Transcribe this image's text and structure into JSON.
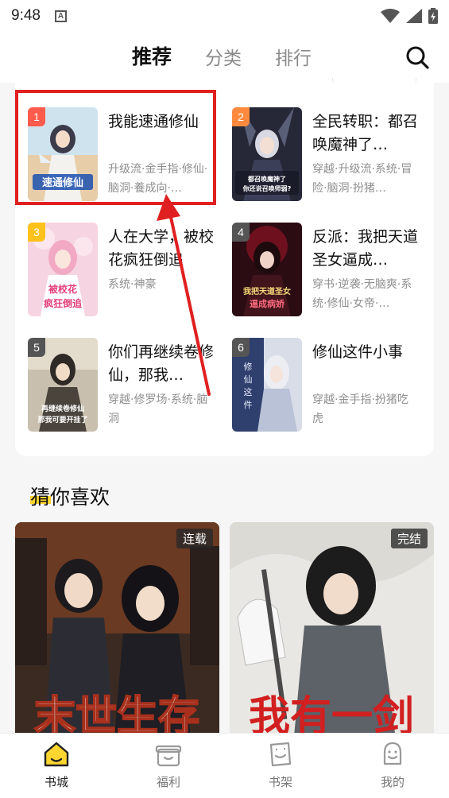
{
  "status_bar": {
    "time": "9:48",
    "notification_icon": "a-icon"
  },
  "top_nav": {
    "tabs": [
      {
        "label": "推荐",
        "active": true
      },
      {
        "label": "分类",
        "active": false
      },
      {
        "label": "排行",
        "active": false
      }
    ]
  },
  "ranking": {
    "books": [
      {
        "rank": "1",
        "title": "我能速通修仙",
        "tags": "升级流·金手指·修仙·脑洞·養成向·…",
        "rank_color": "#ff5b4d",
        "cover_text": "速通修仙"
      },
      {
        "rank": "2",
        "title": "全民转职：都召唤魔神了…",
        "tags": "穿越·升级流·系统·冒险·脑洞·扮猪…",
        "rank_color": "#ff8a3d",
        "cover_text": "都召唤魔神了 你还说召唤师弱?"
      },
      {
        "rank": "3",
        "title": "人在大学，被校花疯狂倒追",
        "tags": "系统·神豪",
        "rank_color": "#ffc21c",
        "cover_text": "被校花疯狂倒追"
      },
      {
        "rank": "4",
        "title": "反派：我把天道圣女逼成…",
        "tags": "穿书·逆袭·无脑爽·系统·修仙·女帝·…",
        "rank_color": "#555555",
        "cover_text": "我把天道圣女逼成病娇"
      },
      {
        "rank": "5",
        "title": "你们再继续卷修仙，那我…",
        "tags": "穿越·修罗场·系统·脑洞",
        "rank_color": "#555555",
        "cover_text": "你们再继续卷修仙 那我可要开挂了"
      },
      {
        "rank": "6",
        "title": "修仙这件小事",
        "tags": "穿越·金手指·扮猪吃虎",
        "rank_color": "#555555",
        "cover_text": "修仙这件小事"
      }
    ]
  },
  "guess_section": {
    "title": "猜你喜欢",
    "items": [
      {
        "badge": "连载",
        "cover_text": "末世生存"
      },
      {
        "badge": "完结",
        "cover_text": "我有一剑"
      }
    ]
  },
  "bottom_nav": {
    "items": [
      {
        "label": "书城",
        "icon": "home-icon",
        "active": true
      },
      {
        "label": "福利",
        "icon": "gift-icon",
        "active": false
      },
      {
        "label": "书架",
        "icon": "bookshelf-icon",
        "active": false
      },
      {
        "label": "我的",
        "icon": "profile-icon",
        "active": false
      }
    ]
  },
  "colors": {
    "accent": "#ffd530",
    "highlight": "#e02020",
    "arrow": "#e02020"
  }
}
